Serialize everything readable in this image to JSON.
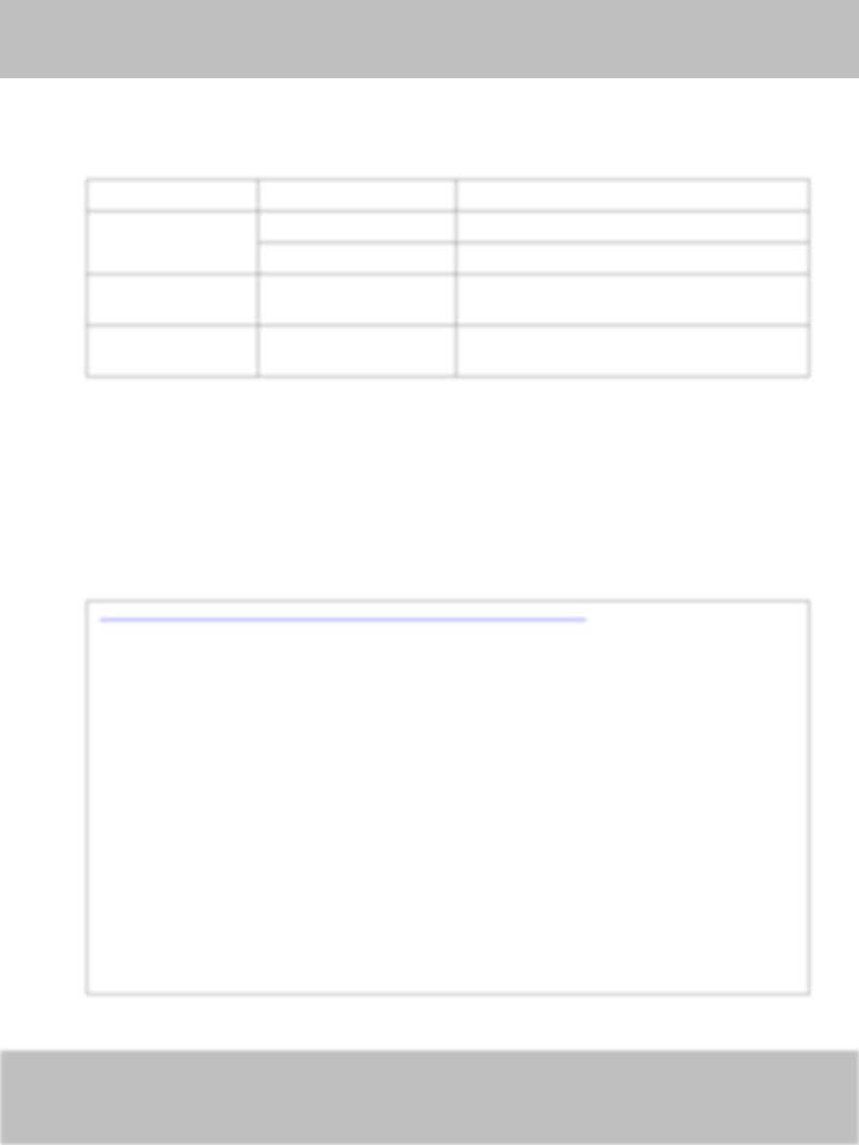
{
  "header": {
    "title": ""
  },
  "table": {
    "rows": []
  },
  "box": {
    "link_text": ""
  }
}
